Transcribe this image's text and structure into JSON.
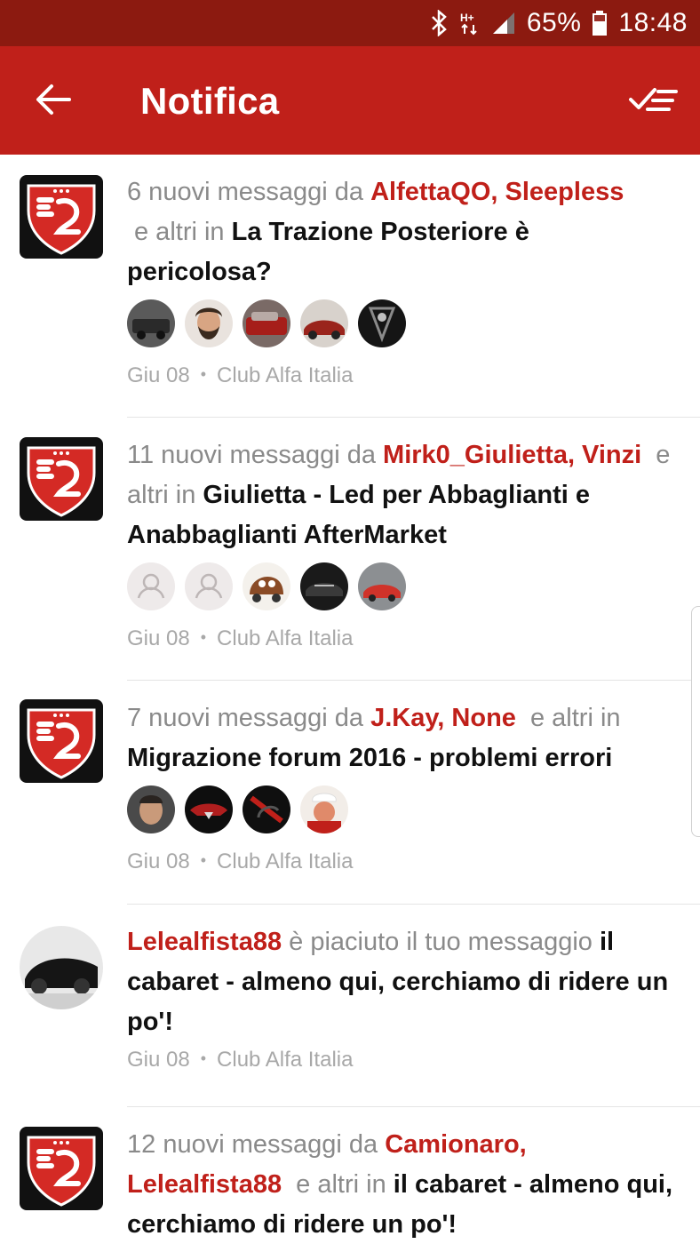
{
  "status_bar": {
    "bluetooth_icon": "bluetooth-icon",
    "network_type": "H+",
    "signal_icon": "signal-icon",
    "battery_percent": "65%",
    "battery_icon": "battery-icon",
    "time": "18:48"
  },
  "app_bar": {
    "title": "Notifica",
    "back_icon": "arrow-left-icon",
    "mark_read_icon": "mark-all-read-icon"
  },
  "colors": {
    "status_bar": "#8c1a10",
    "app_bar": "#c0201a",
    "accent": "#c0201a",
    "meta": "#a8a8a8"
  },
  "notifications": [
    {
      "prefix": "6 nuovi messaggi da ",
      "users": "AlfettaQO, Sleepless",
      "mid": "e altri in ",
      "topic": "La Trazione Posteriore è pericolosa?",
      "date": "Giu 08",
      "forum": "Club Alfa Italia",
      "thumbnails": [
        "car-dark-avatar",
        "bearded-man-avatar",
        "red-car-avatar",
        "red-classic-car-avatar",
        "alfa-grille-avatar"
      ]
    },
    {
      "prefix": "11 nuovi messaggi da ",
      "users": "Mirk0_Giulietta, Vinzi",
      "mid": "e altri in ",
      "topic": "Giulietta - Led per Abbaglianti e Anabbaglianti AfterMarket",
      "date": "Giu 08",
      "forum": "Club Alfa Italia",
      "thumbnails": [
        "default-user-avatar",
        "default-user-avatar",
        "cartoon-truck-avatar",
        "black-car-avatar",
        "red-car-avatar"
      ]
    },
    {
      "prefix": "7 nuovi messaggi da ",
      "users": "J.Kay, None",
      "mid": "e altri in",
      "topic": "Migrazione forum 2016 - problemi errori",
      "date": "Giu 08",
      "forum": "Club Alfa Italia",
      "thumbnails": [
        "man-portrait-avatar",
        "red-car-front-avatar",
        "dark-car-avatar",
        "chef-avatar"
      ]
    },
    {
      "users": "Lelealfista88",
      "mid": " è piaciuto il tuo messaggio ",
      "topic": "il cabaret - almeno qui, cerchiamo di ridere un po'!",
      "date": "Giu 08",
      "forum": "Club Alfa Italia"
    },
    {
      "prefix": "12 nuovi messaggi da ",
      "users": "Camionaro, Lelealfista88",
      "mid": "e altri in ",
      "topic": "il cabaret - almeno qui, cerchiamo di ridere un po'!"
    }
  ]
}
